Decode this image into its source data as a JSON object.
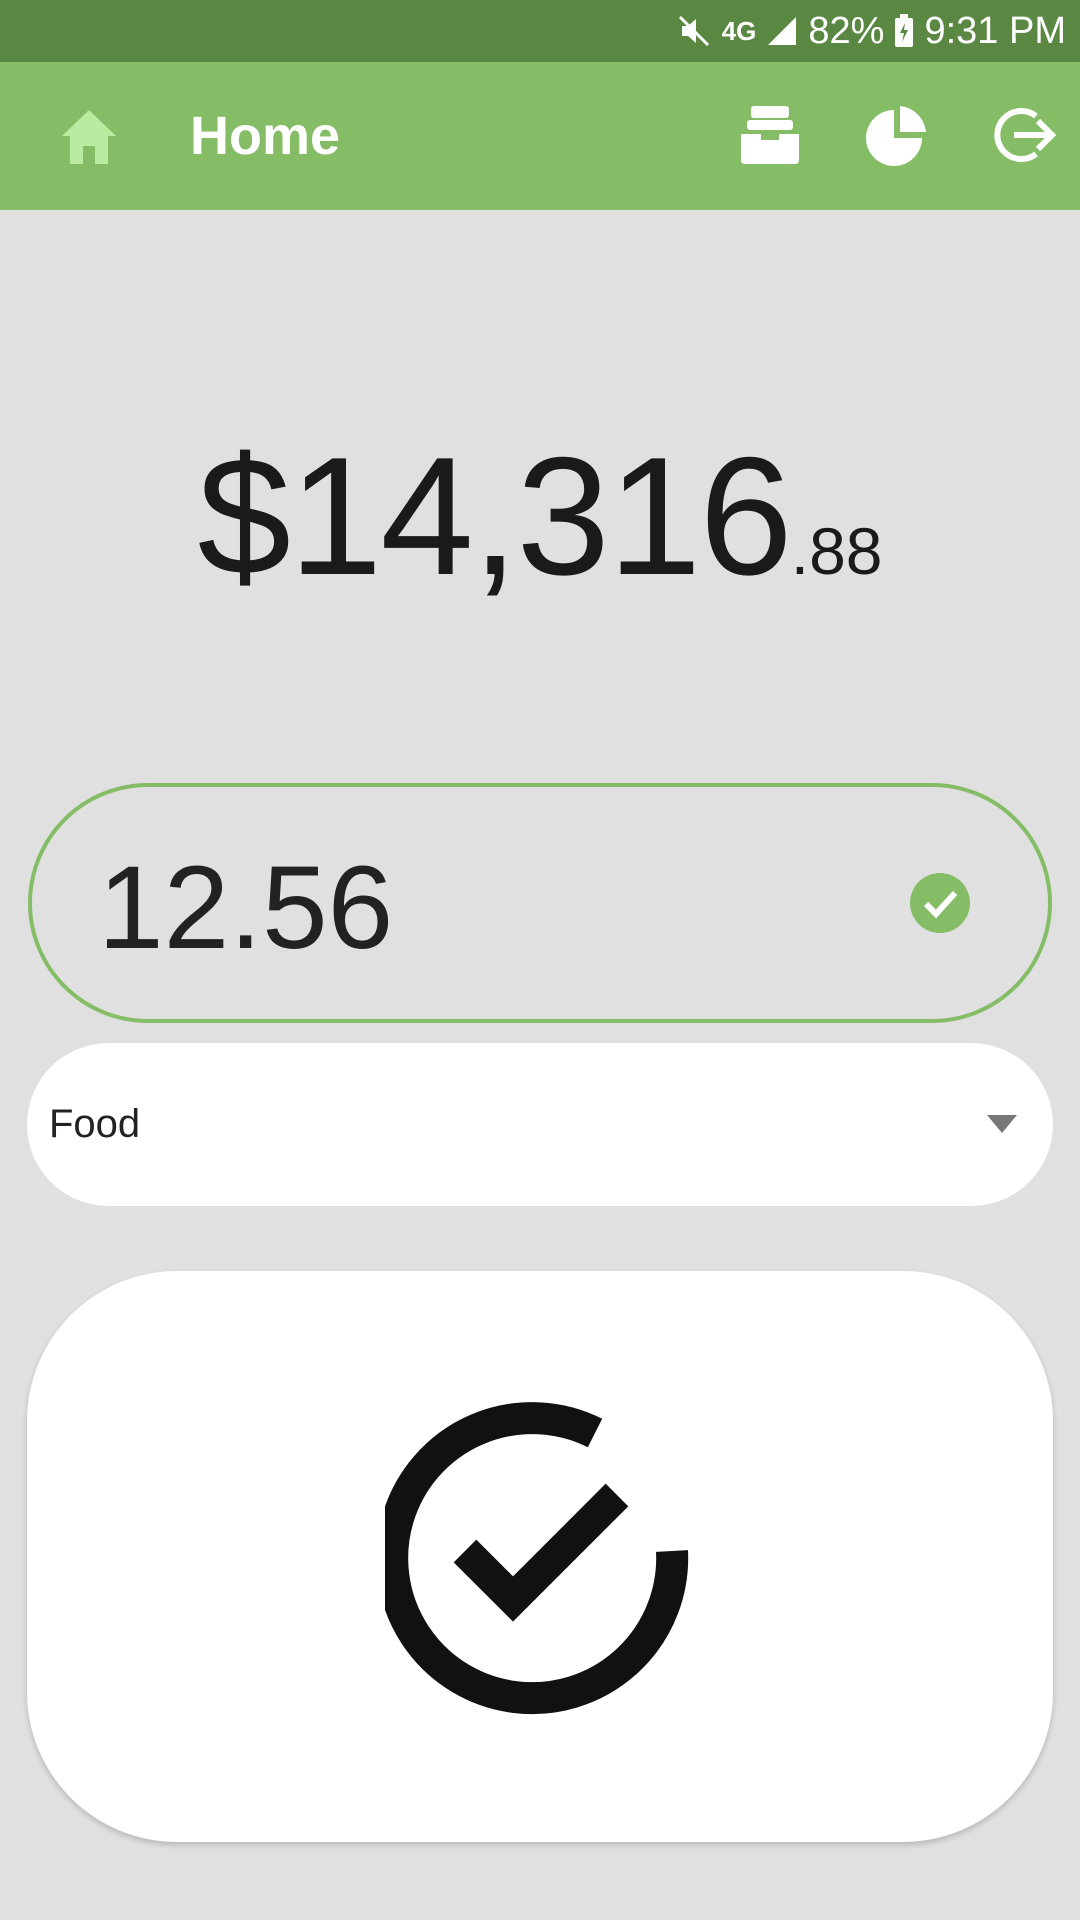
{
  "status_bar": {
    "network": "4G",
    "battery_percent": "82%",
    "time": "9:31 PM",
    "icons": [
      "mute-icon",
      "lte-icon",
      "signal-icon",
      "battery-charging-icon"
    ]
  },
  "app_bar": {
    "title": "Home",
    "icons": [
      "home-icon",
      "inbox-icon",
      "pie-chart-icon",
      "logout-icon"
    ]
  },
  "balance": {
    "major": "$14,316",
    "minor": ".88"
  },
  "amount_input": {
    "value": "12.56"
  },
  "category_select": {
    "selected": "Food"
  },
  "colors": {
    "status_bar": "#5a8843",
    "app_bar": "#85bd66",
    "accent": "#85bd66",
    "background": "#e0e0e0",
    "home_icon": "#b9eba0"
  }
}
